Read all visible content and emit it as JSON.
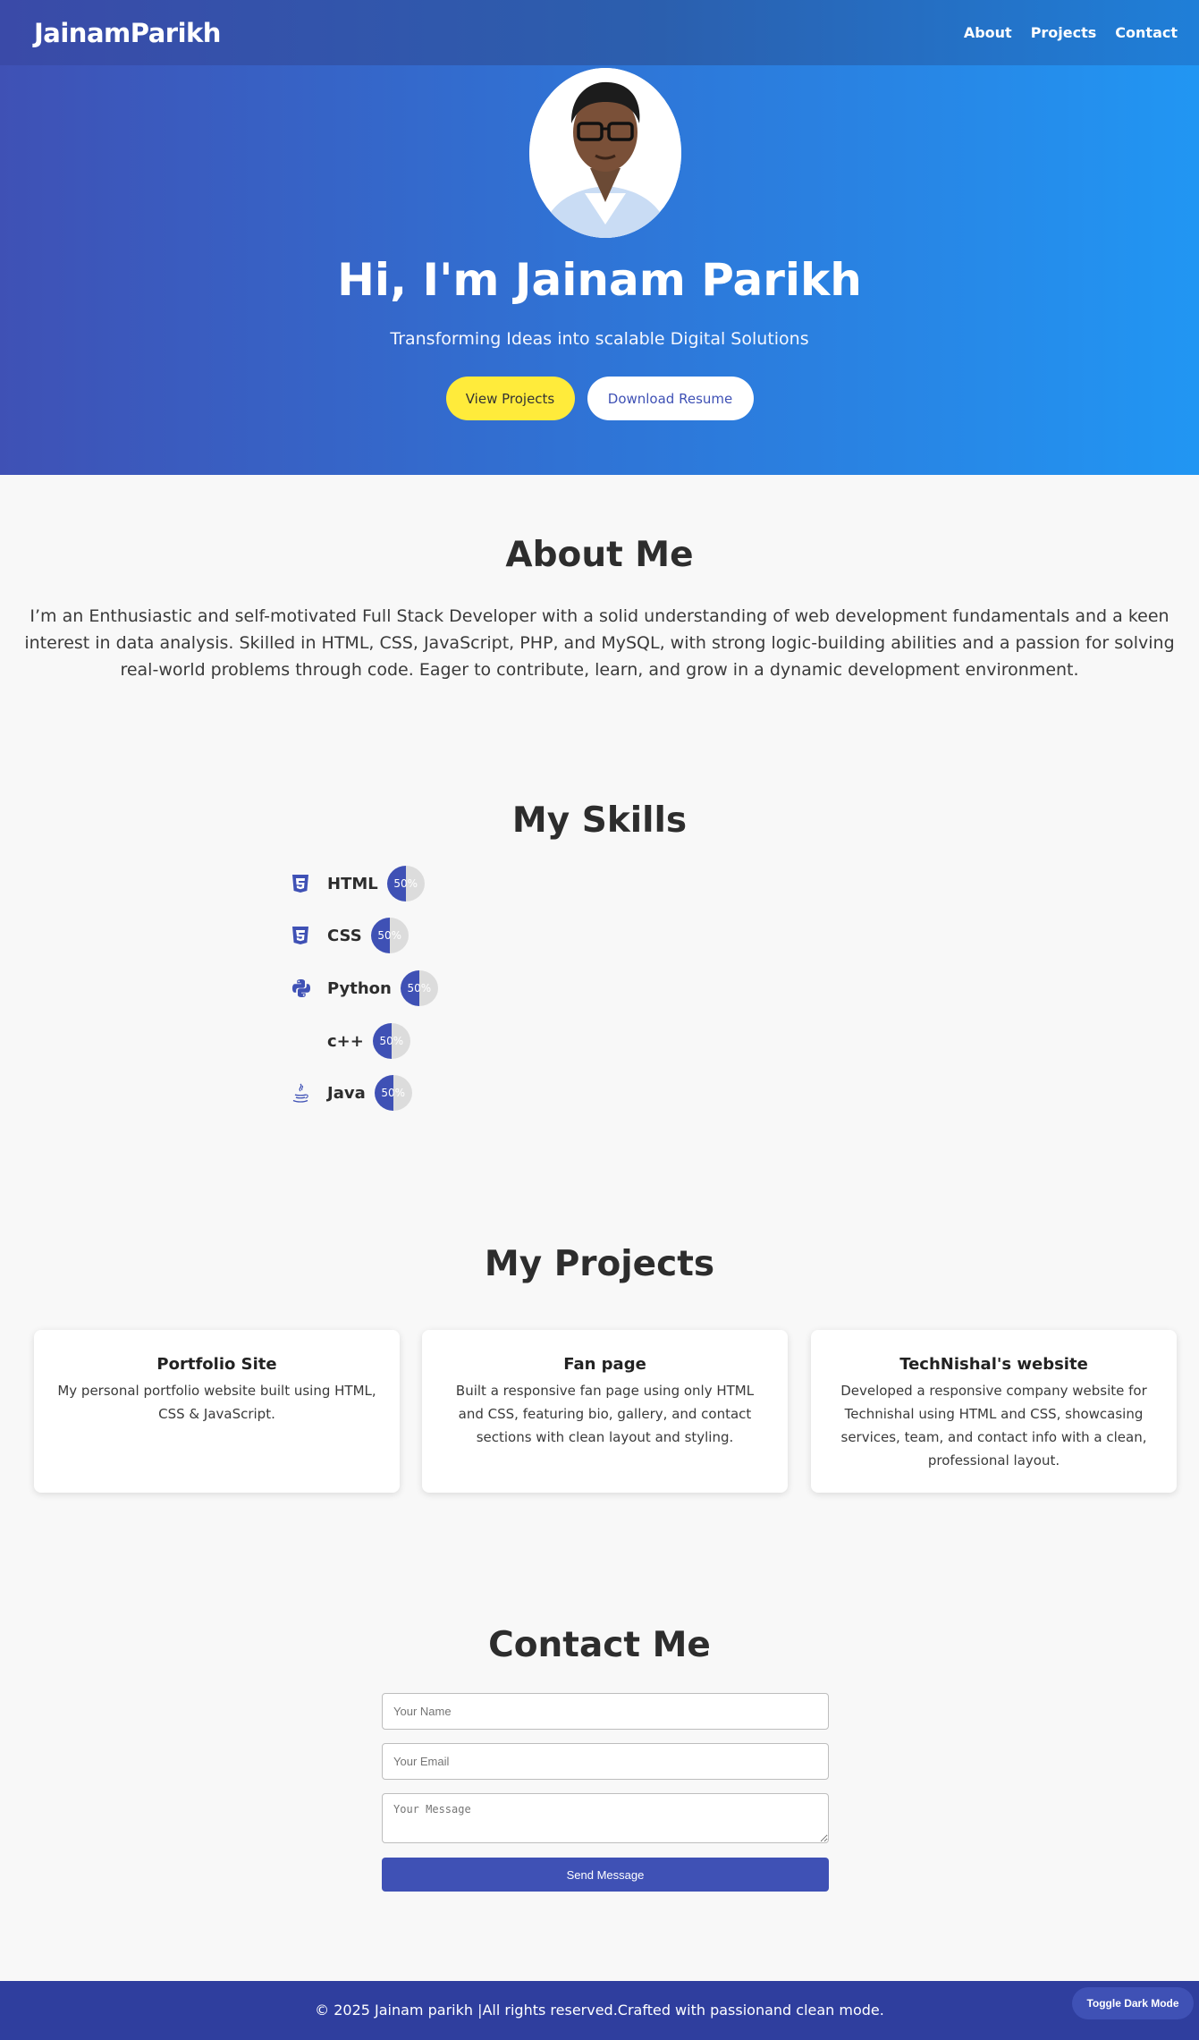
{
  "nav": {
    "logo": "JainamParikh",
    "links": [
      "About",
      "Projects",
      "Contact"
    ]
  },
  "hero": {
    "title": "Hi, I'm Jainam Parikh",
    "subtitle": "Transforming Ideas into scalable Digital Solutions",
    "primary_button": "View Projects",
    "secondary_button": "Download Resume"
  },
  "about": {
    "heading": "About Me",
    "text": "I’m an Enthusiastic and self-motivated Full Stack Developer with a solid understanding of web development fundamentals and a keen interest in data analysis. Skilled in HTML, CSS, JavaScript, PHP, and MySQL, with strong logic-building abilities and a passion for solving real-world problems through code. Eager to contribute, learn, and grow in a dynamic development environment."
  },
  "skills": {
    "heading": "My Skills",
    "items": [
      {
        "name": "HTML",
        "percent_label": "50%",
        "level": 0.5,
        "icon": "html5-icon"
      },
      {
        "name": "CSS",
        "percent_label": "50%",
        "level": 0.5,
        "icon": "css3-icon"
      },
      {
        "name": "Python",
        "percent_label": "50%",
        "level": 0.5,
        "icon": "python-icon"
      },
      {
        "name": "c++",
        "percent_label": "50%",
        "level": 0.5,
        "icon": ""
      },
      {
        "name": "Java",
        "percent_label": "50%",
        "level": 0.5,
        "icon": "java-icon"
      }
    ]
  },
  "projects": {
    "heading": "My Projects",
    "items": [
      {
        "title": "Portfolio Site",
        "description": "My personal portfolio website built using HTML, CSS & JavaScript."
      },
      {
        "title": "Fan page",
        "description": "Built a responsive fan page using only HTML and CSS, featuring bio, gallery, and contact sections with clean layout and styling."
      },
      {
        "title": "TechNishal's website",
        "description": "Developed a responsive company website for Technishal using HTML and CSS, showcasing services, team, and contact info with a clean, professional layout."
      }
    ]
  },
  "contact": {
    "heading": "Contact Me",
    "name_placeholder": "Your Name",
    "email_placeholder": "Your Email",
    "message_placeholder": "Your Message",
    "send_label": "Send Message"
  },
  "footer": {
    "text": "© 2025 Jainam parikh |All rights reserved.Crafted with passionand clean mode.",
    "toggle_label": "Toggle Dark Mode"
  },
  "colors": {
    "primary": "#3f51b5",
    "accent_blue": "#2196f3",
    "yellow": "#ffeb3b",
    "footer_bg": "#2f3e9e"
  }
}
